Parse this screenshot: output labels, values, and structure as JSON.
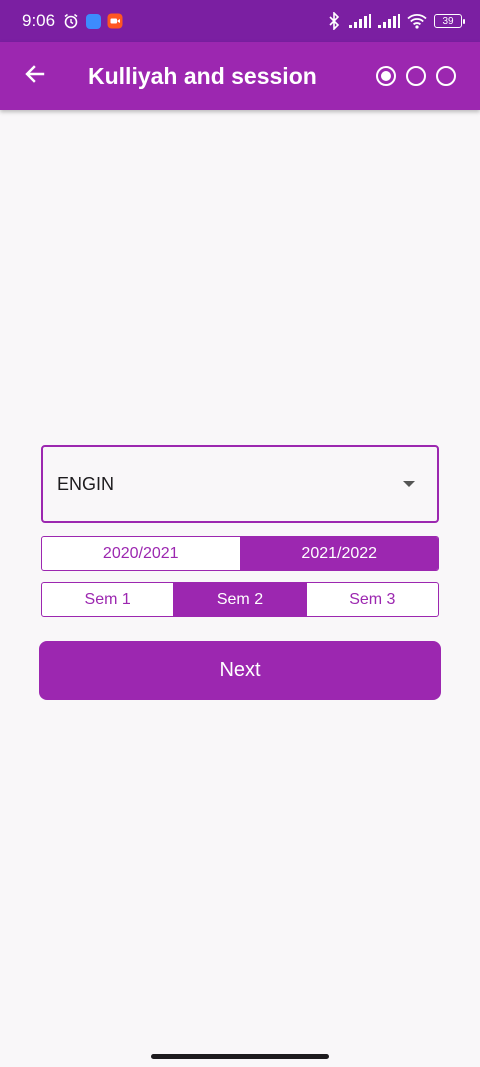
{
  "status_bar": {
    "time": "9:06",
    "battery": "39",
    "icons": [
      "alarm-icon",
      "app-notification-icon",
      "camera-notification-icon",
      "bluetooth-icon",
      "signal-icon",
      "signal-icon",
      "wifi-icon",
      "battery-icon"
    ]
  },
  "app_bar": {
    "title": "Kulliyah and session",
    "back_icon": "arrow-left-icon",
    "steps": {
      "total": 3,
      "active": 1
    }
  },
  "form": {
    "kulliyah": {
      "selected": "ENGIN",
      "icon": "dropdown-caret-icon"
    },
    "sessions": {
      "options": [
        "2020/2021",
        "2021/2022"
      ],
      "selected": "2021/2022"
    },
    "semesters": {
      "options": [
        "Sem 1",
        "Sem 2",
        "Sem 3"
      ],
      "selected": "Sem 2"
    },
    "next_label": "Next"
  },
  "colors": {
    "status_bar": "#7b1fa2",
    "primary": "#9c27b0",
    "background": "#f9f7f9",
    "on_primary": "#ffffff"
  }
}
